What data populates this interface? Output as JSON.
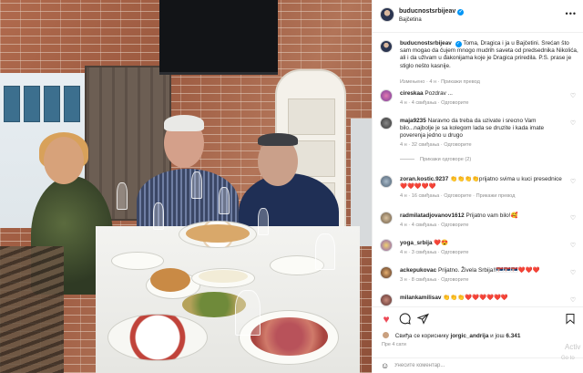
{
  "post": {
    "username": "buducnostsrbijeav",
    "location": "Bajčetina",
    "more_icon": "more-horizontal-icon",
    "caption": "Toma, Dragica i ja u Bajčetini. Srećan što sam mogao da čujem mnogo mudrih saveta od predsednika Nikolića, ali i da uživam u đakonijama koje je Dragica priredila. P.S. prase je stiglo nešto kasnije.",
    "caption_meta": "Измењено · 4 н · Прикажи превод"
  },
  "comments": [
    {
      "user": "cireskaa",
      "text": "Pozdrav ...",
      "meta": "4 н · 4 свиђања · Одговорите"
    },
    {
      "user": "maja9235",
      "text": "Naravno da treba da uzivate i srecno Vam bilo...najbolje je sa kolegom lada se druzite i kada imate poverenja jedno u drugo",
      "meta": "4 н · 32 свиђања · Одговорите",
      "replies": "Прикажи одговоре (2)"
    },
    {
      "user": "zoran.kostic.9237",
      "text": "👏👏👏👏prijatno svima u kuci presednice❤️❤️❤️❤️❤️",
      "meta": "4 н · 16 свиђања · Одговорите · Прикажи превод"
    },
    {
      "user": "radmilatadjovanov1612",
      "text": "Prijatno vam bilo!🥰",
      "meta": "4 н · 4 свиђања · Одговорите"
    },
    {
      "user": "yoga_srbija",
      "text": "❤️😍",
      "meta": "4 н · 3 свиђања · Одговорите"
    },
    {
      "user": "ackepukovac",
      "text": "Prijatno. Živela Srbija!!🇷🇸🇷🇸🇷🇸❤️❤️❤️",
      "meta": "3 н · 8 свиђања · Одговорите"
    },
    {
      "user": "milankamilisav",
      "text": "👏👏👏❤️❤️❤️❤️❤️❤️",
      "meta": ""
    }
  ],
  "actions": {
    "like_icon": "heart-filled-icon",
    "comment_icon": "comment-icon",
    "share_icon": "share-icon",
    "save_icon": "bookmark-icon",
    "like_color": "#ed4956"
  },
  "likes": {
    "prefix": "Свиђа се кориснику",
    "user": "jorgic_andrija",
    "middle": "и још",
    "count": "6.341"
  },
  "timestamp": "Пре 4 сати",
  "add_comment": {
    "placeholder": "Унесите коментар..."
  },
  "watermark": {
    "line1": "Activ",
    "line2": "Go to"
  }
}
